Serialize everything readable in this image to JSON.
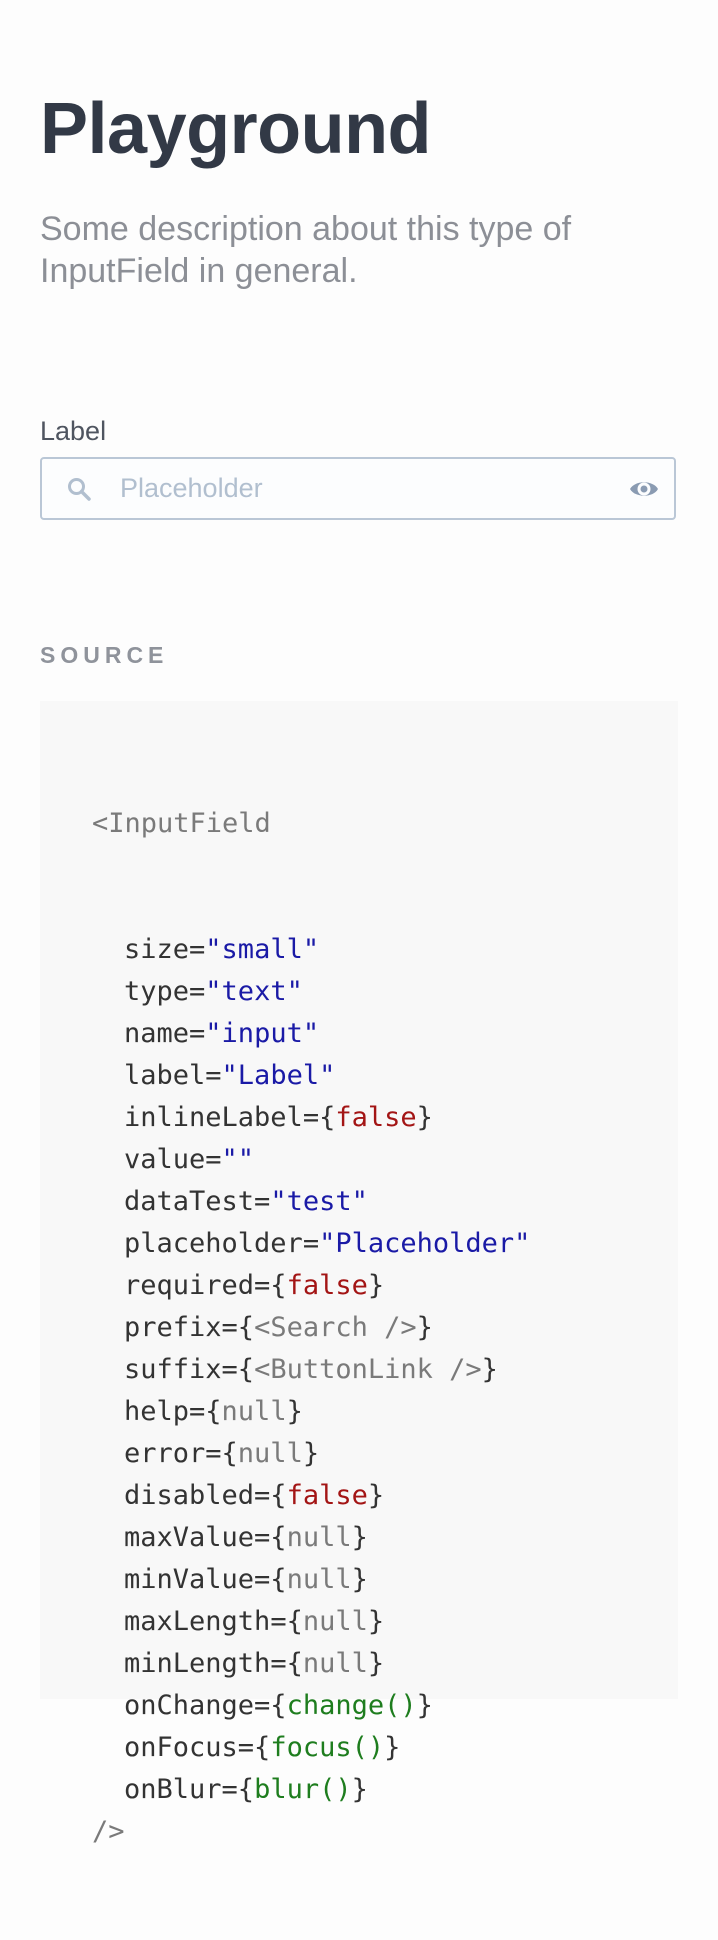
{
  "header": {
    "title": "Playground",
    "description": "Some description about this type of InputField in general."
  },
  "input_field": {
    "label": "Label",
    "placeholder": "Placeholder",
    "value": "",
    "prefix_icon": "search-icon",
    "suffix_icon": "eye-icon"
  },
  "source": {
    "section_title": "SOURCE",
    "open_tag": "<InputField",
    "close_tag": "/>",
    "props": [
      {
        "name": "size",
        "kind": "string",
        "value": "\"small\""
      },
      {
        "name": "type",
        "kind": "string",
        "value": "\"text\""
      },
      {
        "name": "name",
        "kind": "string",
        "value": "\"input\""
      },
      {
        "name": "label",
        "kind": "string",
        "value": "\"Label\""
      },
      {
        "name": "inlineLabel",
        "kind": "bool",
        "value": "false"
      },
      {
        "name": "value",
        "kind": "string",
        "value": "\"\""
      },
      {
        "name": "dataTest",
        "kind": "string",
        "value": "\"test\""
      },
      {
        "name": "placeholder",
        "kind": "string",
        "value": "\"Placeholder\""
      },
      {
        "name": "required",
        "kind": "bool",
        "value": "false"
      },
      {
        "name": "prefix",
        "kind": "jsx",
        "value": "<Search />"
      },
      {
        "name": "suffix",
        "kind": "jsx",
        "value": "<ButtonLink />"
      },
      {
        "name": "help",
        "kind": "null",
        "value": "null"
      },
      {
        "name": "error",
        "kind": "null",
        "value": "null"
      },
      {
        "name": "disabled",
        "kind": "bool",
        "value": "false"
      },
      {
        "name": "maxValue",
        "kind": "null",
        "value": "null"
      },
      {
        "name": "minValue",
        "kind": "null",
        "value": "null"
      },
      {
        "name": "maxLength",
        "kind": "null",
        "value": "null"
      },
      {
        "name": "minLength",
        "kind": "null",
        "value": "null"
      },
      {
        "name": "onChange",
        "kind": "func",
        "value": "change()"
      },
      {
        "name": "onFocus",
        "kind": "func",
        "value": "focus()"
      },
      {
        "name": "onBlur",
        "kind": "func",
        "value": "blur()"
      }
    ]
  },
  "colors": {
    "title": "#323946",
    "description": "#8c8f96",
    "input_border": "#bac7d6",
    "icon": "#b1bfcf",
    "code_background": "#f8f8f8"
  }
}
